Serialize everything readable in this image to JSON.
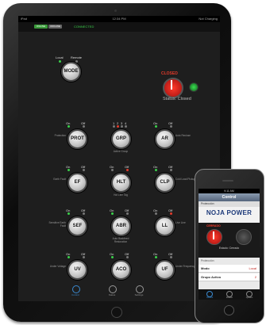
{
  "ipad": {
    "status": {
      "left": "iPad",
      "time": "12:34 PM",
      "right": "Not Charging"
    },
    "mode_tabs": [
      "ONLINE",
      "OFFLINE"
    ],
    "connection": "CONNECTED",
    "mode_switch": {
      "local": "Local",
      "remote": "Remote",
      "knob": "MODE"
    },
    "breaker": {
      "state": "CLOSED",
      "status": "Status: Closed"
    },
    "on": "On",
    "off": "Off",
    "rows": [
      {
        "knob": "PROT",
        "side": "Protection"
      },
      {
        "knob": "GRP",
        "side": "Active Group",
        "digits": [
          "1",
          "2",
          "3",
          "4"
        ]
      },
      {
        "knob": "AR",
        "side": "Auto Reclose"
      },
      {
        "knob": "EF",
        "side": "Earth Fault"
      },
      {
        "knob": "HLT",
        "side": "Hot Line Tag"
      },
      {
        "knob": "CLP",
        "side": "Cold Load Pickup"
      },
      {
        "knob": "SEF",
        "side": "Sensitive Earth Fault"
      },
      {
        "knob": "ABR",
        "side": "Auto Backfeed Restoration"
      },
      {
        "knob": "LL",
        "side": "Live Line"
      },
      {
        "knob": "UV",
        "side": "Under Voltage"
      },
      {
        "knob": "ACO",
        "side": ""
      },
      {
        "knob": "UF",
        "side": "Under Frequency"
      }
    ],
    "tabbar": [
      "Control",
      "Status",
      "Settings"
    ]
  },
  "iphone": {
    "status_time": "9:11 AM",
    "title": "Control",
    "subtitle": "Protección",
    "logo": "NOJA POWER",
    "breaker": {
      "state": "CERRADO",
      "status": "Estado: Cerrado"
    },
    "section": "Protección",
    "rows": [
      {
        "label": "Modo",
        "value": "Local"
      },
      {
        "label": "Grupo Activo",
        "value": "2"
      }
    ],
    "tabbar": [
      "Control",
      "Estado",
      "Ajustes"
    ]
  }
}
